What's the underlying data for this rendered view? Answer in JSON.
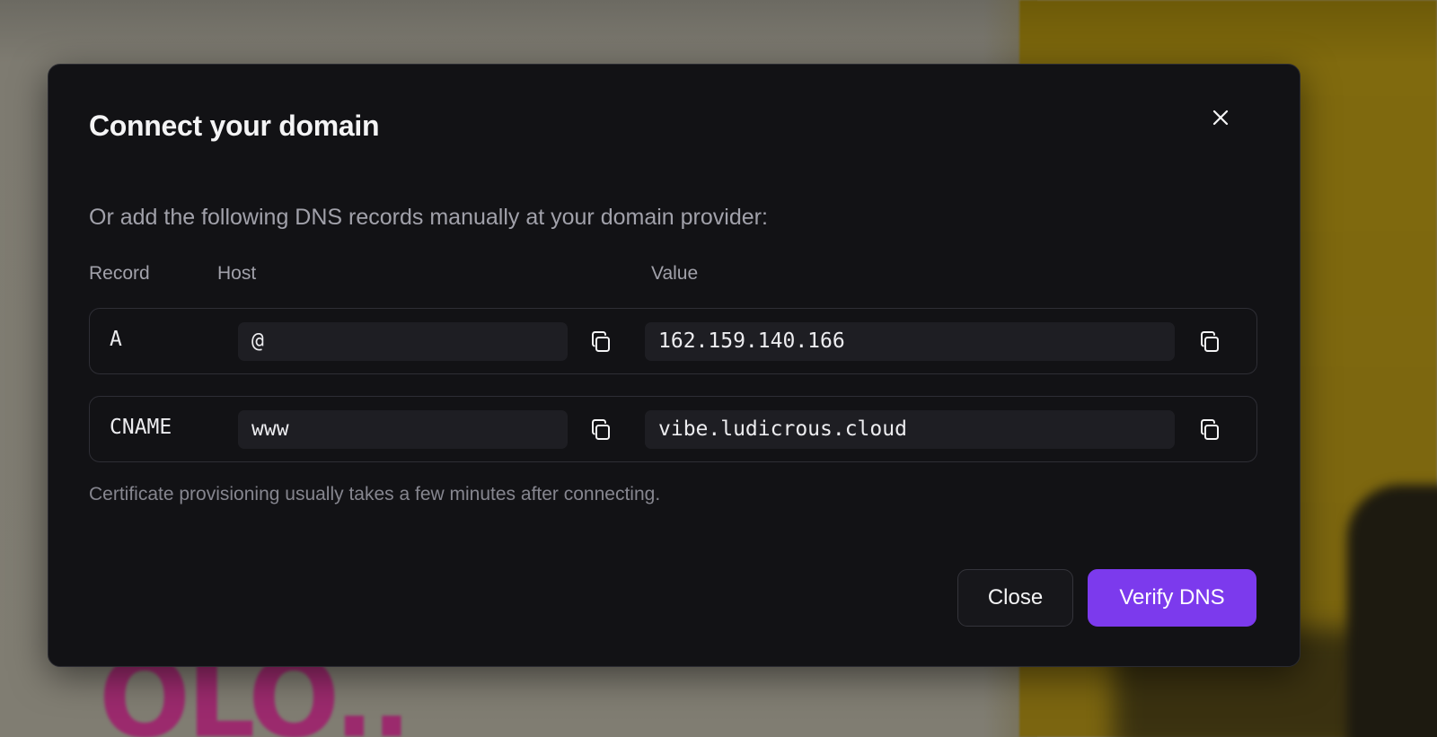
{
  "background": {
    "partial_text": "OLO...",
    "left_color": "#807d72",
    "right_color": "#7b6510"
  },
  "modal": {
    "title": "Connect your domain",
    "close_icon": "close-icon",
    "instructions": "Or add the following DNS records manually at your domain provider:",
    "columns": {
      "record": "Record",
      "host": "Host",
      "value": "Value"
    },
    "records": [
      {
        "type": "A",
        "host": "@",
        "value": "162.159.140.166"
      },
      {
        "type": "CNAME",
        "host": "www",
        "value": "vibe.ludicrous.cloud"
      }
    ],
    "copy_icon": "copy-icon",
    "footnote": "Certificate provisioning usually takes a few minutes after connecting.",
    "buttons": {
      "close": "Close",
      "verify": "Verify DNS"
    },
    "colors": {
      "surface": "#121215",
      "field": "#1e1e23",
      "accent": "#7c3aed",
      "text": "#f4f4f5",
      "muted": "#a1a1aa"
    }
  }
}
